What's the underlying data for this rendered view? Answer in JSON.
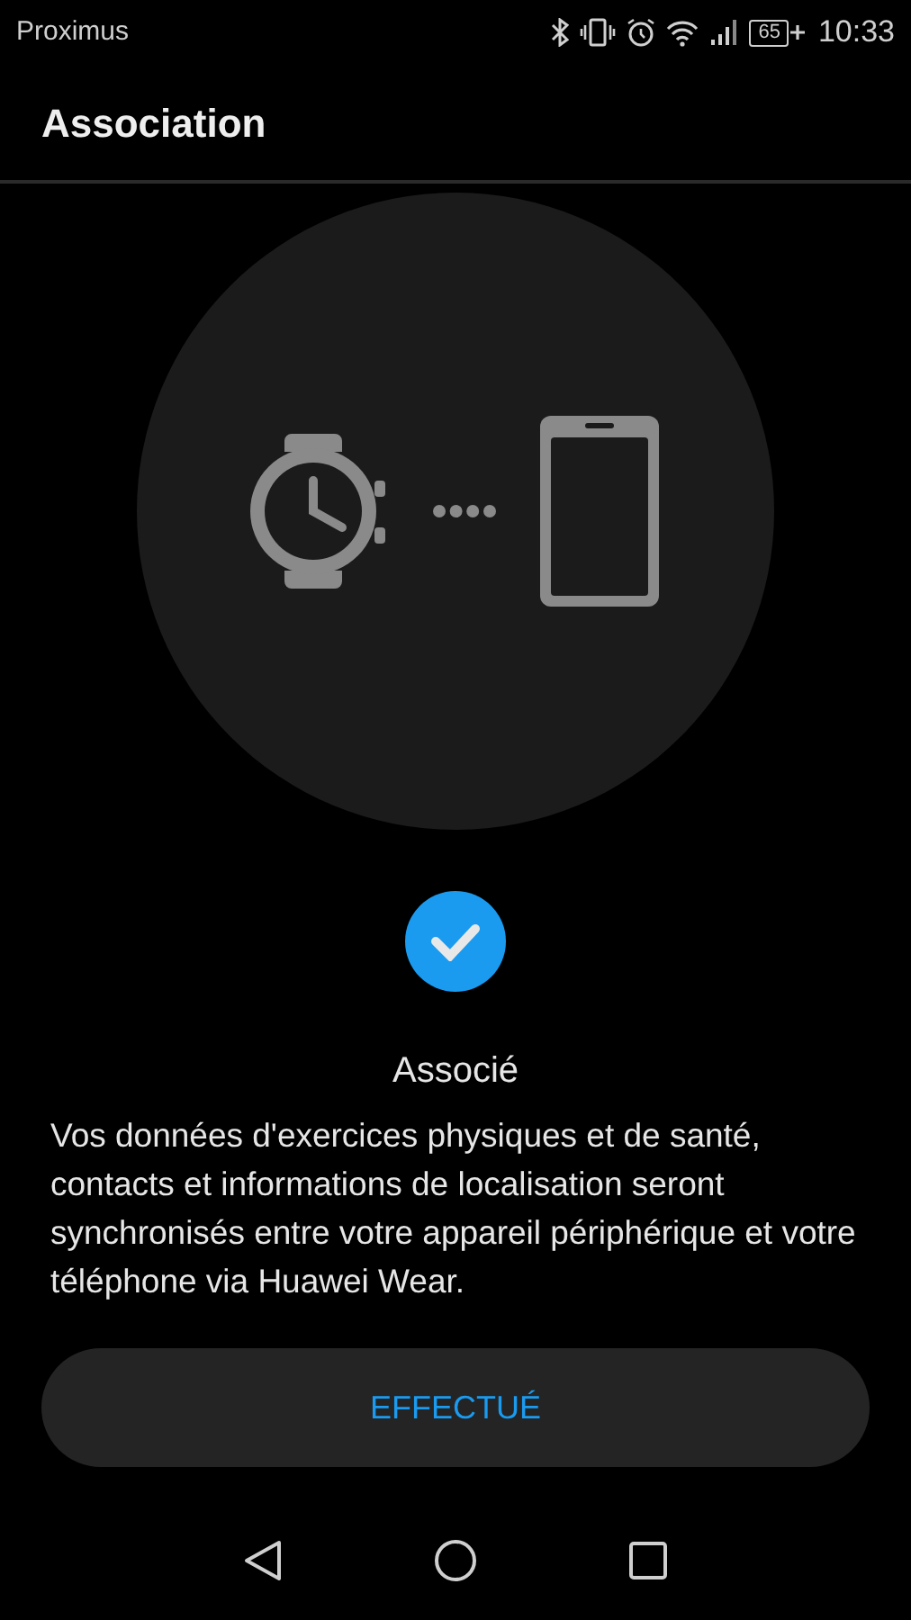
{
  "status_bar": {
    "carrier": "Proximus",
    "battery": "65",
    "time": "10:33"
  },
  "app_bar": {
    "title": "Association"
  },
  "status": {
    "paired": true,
    "label": "Associé"
  },
  "message": "Vos données d'exercices physiques et de santé, contacts et informations de localisation seront synchronisés entre votre appareil périphérique et votre téléphone via Huawei Wear.",
  "button": {
    "label": "EFFECTUÉ"
  }
}
